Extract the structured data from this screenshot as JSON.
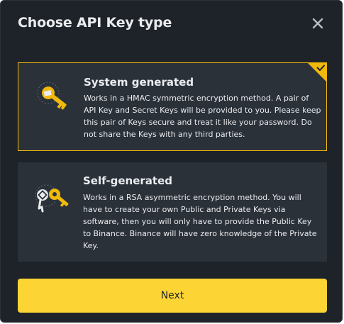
{
  "dialog": {
    "title": "Choose API Key type",
    "close_icon": "close-icon"
  },
  "options": [
    {
      "title": "System generated",
      "description": "Works in a HMAC symmetric encryption method. A pair of API Key and Secret Keys will be provided to you. Please keep this pair of Keys secure and treat it like your password. Do not share the Keys with any third parties.",
      "icon": "key-icon",
      "selected": true
    },
    {
      "title": "Self-generated",
      "description": "Works in a RSA asymmetric encryption method. You will have to create your own Public and Private Keys via software, then you will only have to provide the Public Key to Binance. Binance will have zero knowledge of the Private Key.",
      "icon": "key-pair-icon",
      "selected": false
    }
  ],
  "next_button": {
    "label": "Next"
  },
  "colors": {
    "background": "#1e2329",
    "card": "#2b3139",
    "accent": "#fcd535",
    "selected_border": "#f0b90b",
    "text": "#eaecef"
  }
}
